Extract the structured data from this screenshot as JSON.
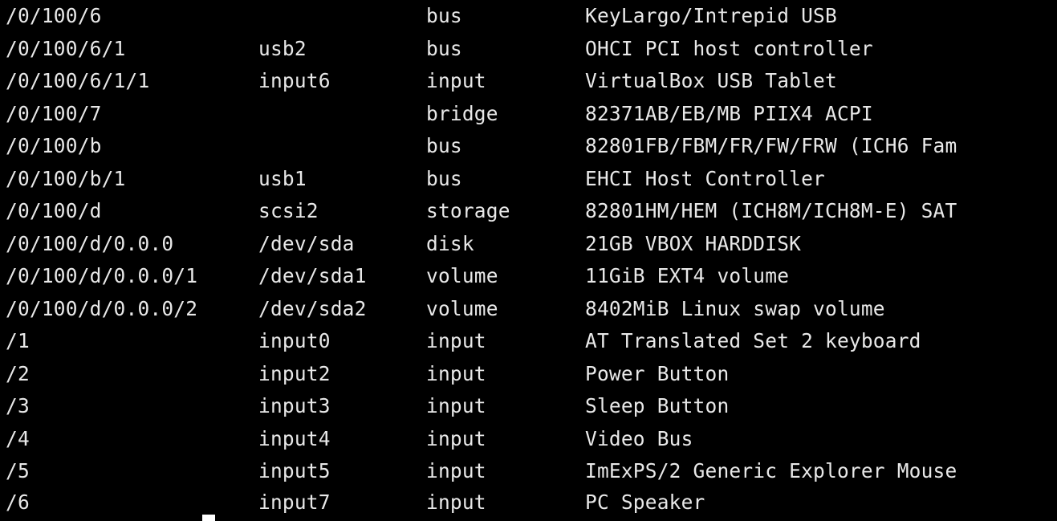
{
  "rows": [
    {
      "path": "/0/100/6",
      "device": "",
      "class": "bus",
      "description": "KeyLargo/Intrepid USB"
    },
    {
      "path": "/0/100/6/1",
      "device": "usb2",
      "class": "bus",
      "description": "OHCI PCI host controller"
    },
    {
      "path": "/0/100/6/1/1",
      "device": "input6",
      "class": "input",
      "description": "VirtualBox USB Tablet"
    },
    {
      "path": "/0/100/7",
      "device": "",
      "class": "bridge",
      "description": "82371AB/EB/MB PIIX4 ACPI"
    },
    {
      "path": "/0/100/b",
      "device": "",
      "class": "bus",
      "description": "82801FB/FBM/FR/FW/FRW (ICH6 Fam"
    },
    {
      "path": "/0/100/b/1",
      "device": "usb1",
      "class": "bus",
      "description": "EHCI Host Controller"
    },
    {
      "path": "/0/100/d",
      "device": "scsi2",
      "class": "storage",
      "description": "82801HM/HEM (ICH8M/ICH8M-E) SAT"
    },
    {
      "path": "/0/100/d/0.0.0",
      "device": "/dev/sda",
      "class": "disk",
      "description": "21GB VBOX HARDDISK"
    },
    {
      "path": "/0/100/d/0.0.0/1",
      "device": "/dev/sda1",
      "class": "volume",
      "description": "11GiB EXT4 volume"
    },
    {
      "path": "/0/100/d/0.0.0/2",
      "device": "/dev/sda2",
      "class": "volume",
      "description": "8402MiB Linux swap volume"
    },
    {
      "path": "/1",
      "device": "input0",
      "class": "input",
      "description": "AT Translated Set 2 keyboard"
    },
    {
      "path": "/2",
      "device": "input2",
      "class": "input",
      "description": "Power Button"
    },
    {
      "path": "/3",
      "device": "input3",
      "class": "input",
      "description": "Sleep Button"
    },
    {
      "path": "/4",
      "device": "input4",
      "class": "input",
      "description": "Video Bus"
    },
    {
      "path": "/5",
      "device": "input5",
      "class": "input",
      "description": "ImExPS/2 Generic Explorer Mouse"
    },
    {
      "path": "/6",
      "device": "input7",
      "class": "input",
      "description": "PC Speaker"
    }
  ],
  "colors": {
    "background": "#000000",
    "text": "#e8e8e8",
    "cursor": "#ffffff"
  }
}
